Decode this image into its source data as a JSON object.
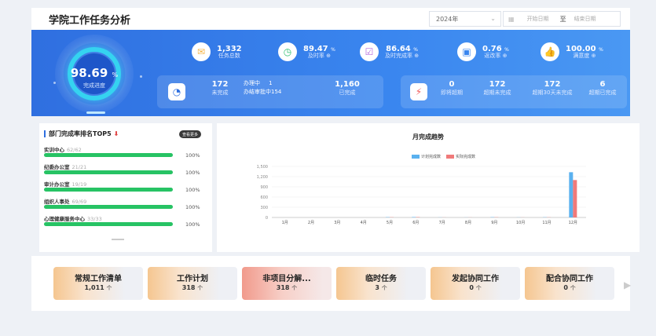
{
  "header": {
    "title": "学院工作任务分析",
    "year": "2024年",
    "start_placeholder": "开始日期",
    "separator": "至",
    "end_placeholder": "结束日期"
  },
  "banner": {
    "progress": {
      "value": "98.69",
      "unit": "%",
      "label": "完成进度"
    },
    "stats": [
      {
        "value": "1,332",
        "unit": "",
        "label": "任务总数",
        "icon": "mail-icon",
        "color": "#f6b547"
      },
      {
        "value": "89.47",
        "unit": "%",
        "label": "及时率 ⊕",
        "icon": "clock-icon",
        "color": "#2fbf71"
      },
      {
        "value": "86.64",
        "unit": "%",
        "label": "及时完成率 ⊕",
        "icon": "checkbox-icon",
        "color": "#b66adf"
      },
      {
        "value": "0.76",
        "unit": "%",
        "label": "返改率 ⊕",
        "icon": "clipboard-icon",
        "color": "#3a86ef"
      },
      {
        "value": "100.00",
        "unit": "%",
        "label": "满意度 ⊕",
        "icon": "thumbs-up-icon",
        "color": "#f05a5a"
      }
    ],
    "status_left": {
      "unfinished_value": "172",
      "unfinished_label": "未完成",
      "processing_label": "办理中",
      "processing_value": "1",
      "approving_label": "办结审批中",
      "approving_value": "154",
      "done_value": "1,160",
      "done_label": "已完成"
    },
    "status_right": [
      {
        "value": "0",
        "label": "即将超期"
      },
      {
        "value": "172",
        "label": "超期未完成"
      },
      {
        "value": "172",
        "label": "超期30天未完成"
      },
      {
        "value": "6",
        "label": "超期已完成"
      }
    ]
  },
  "ranking": {
    "title": "部门完成率排名TOP5",
    "arrow": "⬇",
    "more": "查看更多",
    "items": [
      {
        "name": "实训中心",
        "count": "62/62",
        "pct": "100%",
        "ratio": 1.0
      },
      {
        "name": "纪委办公室",
        "count": "21/21",
        "pct": "100%",
        "ratio": 1.0
      },
      {
        "name": "审计办公室",
        "count": "19/19",
        "pct": "100%",
        "ratio": 1.0
      },
      {
        "name": "组织人事处",
        "count": "69/69",
        "pct": "100%",
        "ratio": 1.0
      },
      {
        "name": "心理健康服务中心",
        "count": "33/33",
        "pct": "100%",
        "ratio": 1.0
      }
    ]
  },
  "chart": {
    "title": "月完成趋势"
  },
  "chart_data": {
    "type": "bar",
    "categories": [
      "1月",
      "2月",
      "3月",
      "4月",
      "5月",
      "6月",
      "7月",
      "8月",
      "9月",
      "10月",
      "11月",
      "12月"
    ],
    "series": [
      {
        "name": "计划完成数",
        "color": "#5ab1ef",
        "values": [
          0,
          0,
          0,
          0,
          8,
          12,
          3,
          2,
          8,
          3,
          6,
          1330
        ]
      },
      {
        "name": "实际完成数",
        "color": "#f07a7a",
        "values": [
          0,
          0,
          0,
          0,
          6,
          10,
          2,
          2,
          6,
          2,
          5,
          1100
        ]
      }
    ],
    "ylim": [
      0,
      1500
    ],
    "yticks": [
      "0",
      "300",
      "600",
      "900",
      "1,200",
      "1,500"
    ],
    "legend": "top-center",
    "grid": true
  },
  "cards": [
    {
      "title": "常规工作清单",
      "value": "1,011",
      "unit": "个"
    },
    {
      "title": "工作计划",
      "value": "318",
      "unit": "个"
    },
    {
      "title": "非项目分解...",
      "value": "318",
      "unit": "个"
    },
    {
      "title": "临时任务",
      "value": "3",
      "unit": "个"
    },
    {
      "title": "发起协同工作",
      "value": "0",
      "unit": "个"
    },
    {
      "title": "配合协同工作",
      "value": "0",
      "unit": "个"
    }
  ],
  "icons": {
    "calendar": "calendar-icon",
    "next": "chevron-right-icon",
    "dropdown": "chevron-down-icon"
  }
}
